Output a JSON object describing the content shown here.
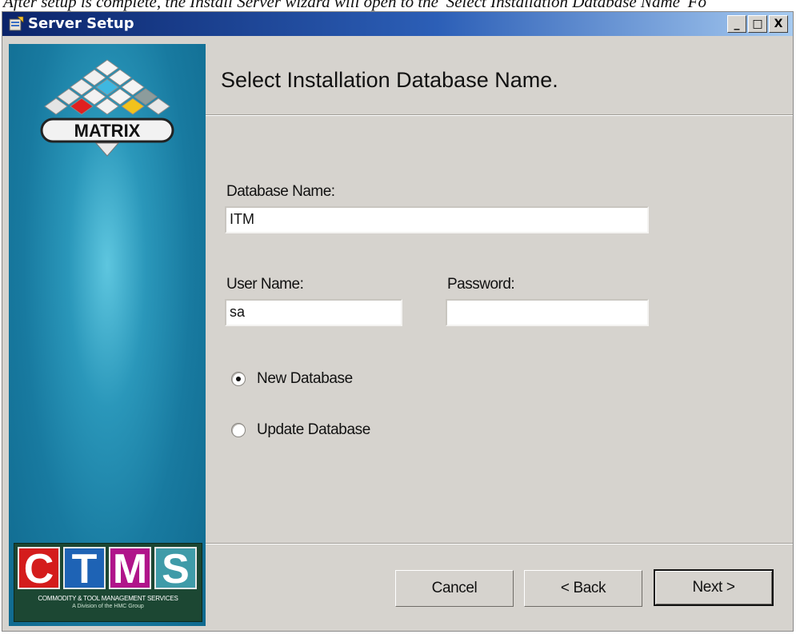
{
  "doc_fragment": "After setup is complete, the Install Server wizard will open to the 'Select Installation Database Name' Fo",
  "window": {
    "title": "Server Setup",
    "controls": {
      "minimize": "_",
      "maximize": "□",
      "close": "X"
    }
  },
  "sidebar": {
    "logo_text": "MATRIX",
    "ctms": {
      "letters": [
        "C",
        "T",
        "M",
        "S"
      ],
      "tagline": "COMMODITY & TOOL MANAGEMENT SERVICES",
      "subtagline": "A Division of the HMC Group"
    }
  },
  "header": {
    "title": "Select Installation Database Name."
  },
  "form": {
    "database_name": {
      "label": "Database Name:",
      "value": "ITM"
    },
    "user_name": {
      "label": "User Name:",
      "value": "sa"
    },
    "password": {
      "label": "Password:",
      "value": ""
    },
    "radios": [
      {
        "label": "New Database",
        "checked": true
      },
      {
        "label": "Update Database",
        "checked": false
      }
    ]
  },
  "buttons": {
    "cancel": "Cancel",
    "back": "< Back",
    "next": "Next >"
  },
  "colors": {
    "ctms_c": "#d41c1c",
    "ctms_t": "#1e63b5",
    "ctms_m": "#b0148a",
    "ctms_s": "#3f9ba8",
    "titlebar": "#0b246a"
  }
}
